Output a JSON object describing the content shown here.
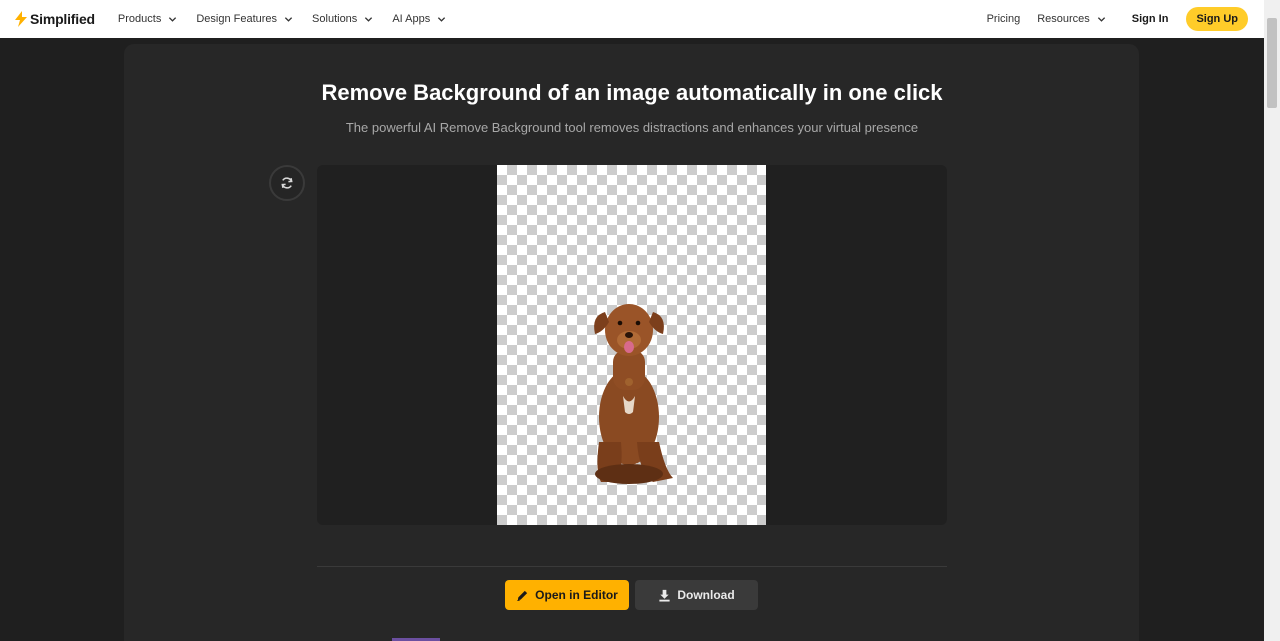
{
  "brand": {
    "name": "Simplified",
    "accent": "#ffcc29"
  },
  "nav": {
    "left_items": [
      {
        "label": "Products"
      },
      {
        "label": "Design Features"
      },
      {
        "label": "Solutions"
      },
      {
        "label": "AI Apps"
      }
    ],
    "pricing": "Pricing",
    "resources": "Resources",
    "sign_in": "Sign In",
    "sign_up": "Sign Up"
  },
  "hero": {
    "title": "Remove Background of an image automatically in one click",
    "subtitle": "The powerful AI Remove Background tool removes distractions and enhances your virtual presence"
  },
  "actions": {
    "open_in_editor": "Open in Editor",
    "download": "Download",
    "editor_color": "#ffb100"
  },
  "icons": {
    "refresh": "refresh-icon",
    "pencil": "pencil-icon",
    "download": "download-icon",
    "chevron": "chevron-down-icon"
  }
}
